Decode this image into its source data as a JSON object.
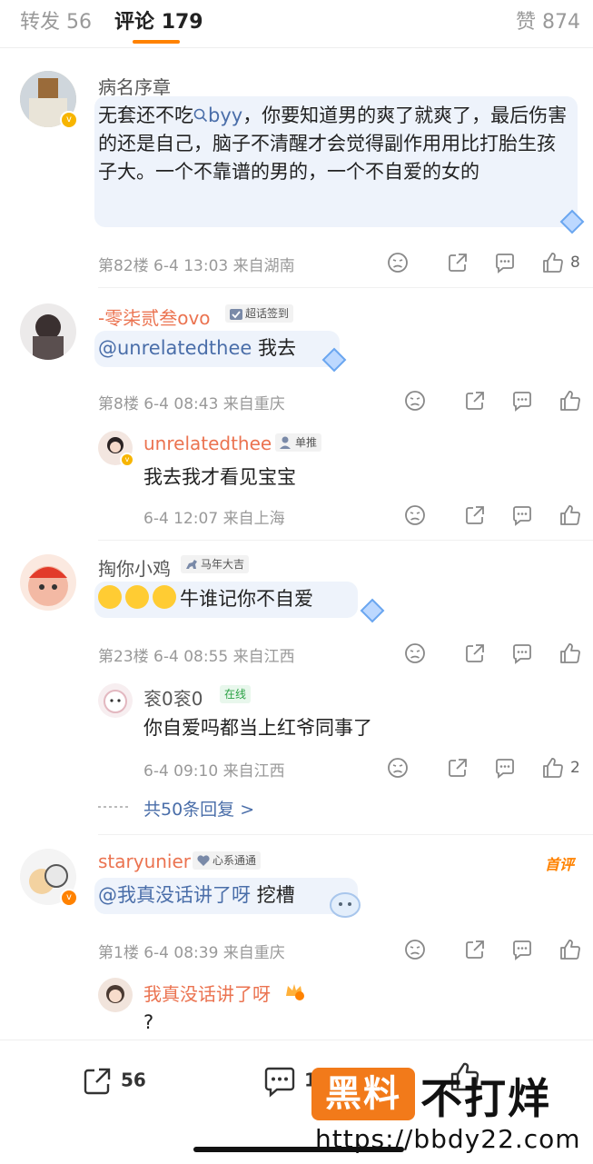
{
  "tabs": {
    "repost_label": "转发",
    "repost_count": "56",
    "comment_label": "评论",
    "comment_count": "179",
    "like_label": "赞",
    "like_count": "874"
  },
  "comments": [
    {
      "user": "病名序章",
      "text_pre": "无套还不吃",
      "search_link": "byy",
      "text_post": "，你要知道男的爽了就爽了，最后伤害的还是自己，脑子不清醒才会觉得副作用用比打胎生孩子大。一个不靠谱的男的，一个不自爱的女的",
      "meta": "第82楼 6-4 13:03 来自湖南",
      "likes": "8"
    },
    {
      "user": "-零柒贰叁ovo",
      "tag": "超话签到",
      "mention": "@unrelatedthee",
      "text": " 我去",
      "meta": "第8楼 6-4 08:43 来自重庆",
      "reply": {
        "user": "unrelatedthee",
        "tag": "单推",
        "text": "我去我才看见宝宝",
        "meta": "6-4 12:07 来自上海"
      }
    },
    {
      "user": "掏你小鸡",
      "tag": "马年大吉",
      "text": "牛谁记你不自爱",
      "meta": "第23楼 6-4 08:55 来自江西",
      "reply": {
        "user": "衮0衮0",
        "tag": "在线",
        "text": "你自爱吗都当上红爷同事了",
        "meta": "6-4 09:10 来自江西",
        "likes": "2"
      },
      "more_replies": "共50条回复 >"
    },
    {
      "user": "staryunier",
      "tag": "心系通通",
      "badge": "首评",
      "mention": "@我真没话讲了呀",
      "text": " 挖槽",
      "meta": "第1楼 6-4 08:39 来自重庆",
      "reply": {
        "user": "我真没话讲了呀",
        "text": "?"
      }
    }
  ],
  "bottom": {
    "repost_count": "56",
    "comment_count": "179"
  },
  "watermark": {
    "box": "黑料",
    "text": "不打烊",
    "url": "https://bbdy22.com"
  },
  "colors": {
    "accent": "#ff8200",
    "link": "#4a6ea9",
    "username_orange": "#eb7350"
  }
}
